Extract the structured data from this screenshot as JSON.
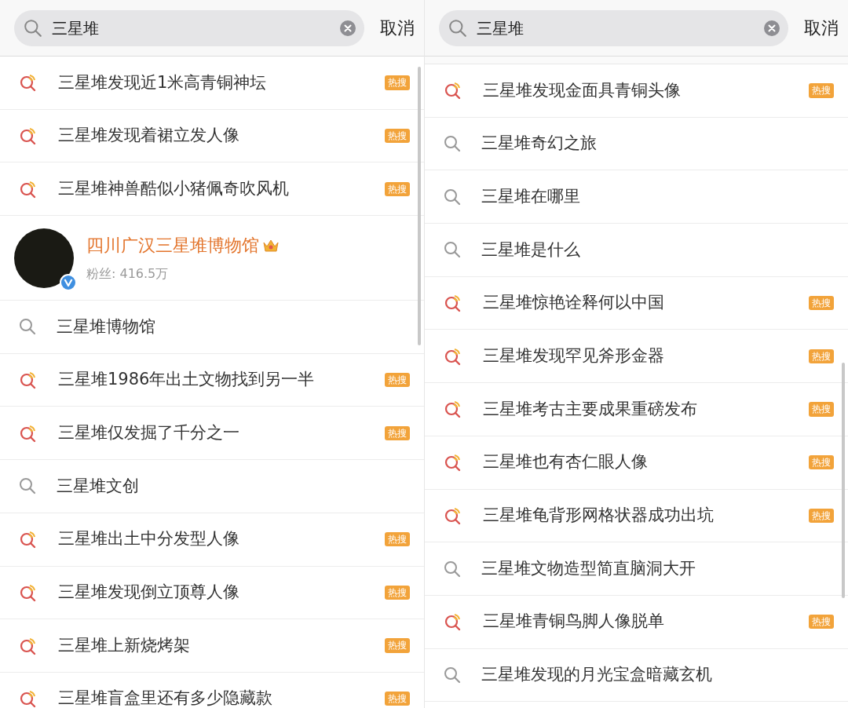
{
  "panels": [
    {
      "search": {
        "value": "三星堆"
      },
      "cancel": "取消",
      "top_gap": false,
      "items": [
        {
          "kind": "hot",
          "text": "三星堆发现近1米高青铜神坛",
          "badge": "热搜"
        },
        {
          "kind": "hot",
          "text": "三星堆发现着裙立发人像",
          "badge": "热搜"
        },
        {
          "kind": "hot",
          "text": "三星堆神兽酷似小猪佩奇吹风机",
          "badge": "热搜"
        },
        {
          "kind": "profile",
          "name": "四川广汉三星堆博物馆",
          "fans": "粉丝: 416.5万",
          "verified": true
        },
        {
          "kind": "search",
          "text": "三星堆博物馆"
        },
        {
          "kind": "hot",
          "text": "三星堆1986年出土文物找到另一半",
          "badge": "热搜"
        },
        {
          "kind": "hot",
          "text": "三星堆仅发掘了千分之一",
          "badge": "热搜"
        },
        {
          "kind": "search",
          "text": "三星堆文创"
        },
        {
          "kind": "hot",
          "text": "三星堆出土中分发型人像",
          "badge": "热搜"
        },
        {
          "kind": "hot",
          "text": "三星堆发现倒立顶尊人像",
          "badge": "热搜"
        },
        {
          "kind": "hot",
          "text": "三星堆上新烧烤架",
          "badge": "热搜"
        },
        {
          "kind": "hot",
          "text": "三星堆盲盒里还有多少隐藏款",
          "badge": "热搜"
        }
      ]
    },
    {
      "search": {
        "value": "三星堆"
      },
      "cancel": "取消",
      "top_gap": true,
      "items": [
        {
          "kind": "hot",
          "text": "三星堆发现金面具青铜头像",
          "badge": "热搜"
        },
        {
          "kind": "search",
          "text": "三星堆奇幻之旅"
        },
        {
          "kind": "search",
          "text": "三星堆在哪里"
        },
        {
          "kind": "search",
          "text": "三星堆是什么"
        },
        {
          "kind": "hot",
          "text": "三星堆惊艳诠释何以中国",
          "badge": "热搜"
        },
        {
          "kind": "hot",
          "text": "三星堆发现罕见斧形金器",
          "badge": "热搜"
        },
        {
          "kind": "hot",
          "text": "三星堆考古主要成果重磅发布",
          "badge": "热搜"
        },
        {
          "kind": "hot",
          "text": "三星堆也有杏仁眼人像",
          "badge": "热搜"
        },
        {
          "kind": "hot",
          "text": "三星堆龟背形网格状器成功出坑",
          "badge": "热搜"
        },
        {
          "kind": "search",
          "text": "三星堆文物造型简直脑洞大开"
        },
        {
          "kind": "hot",
          "text": "三星堆青铜鸟脚人像脱单",
          "badge": "热搜"
        },
        {
          "kind": "search",
          "text": "三星堆发现的月光宝盒暗藏玄机"
        }
      ]
    }
  ]
}
